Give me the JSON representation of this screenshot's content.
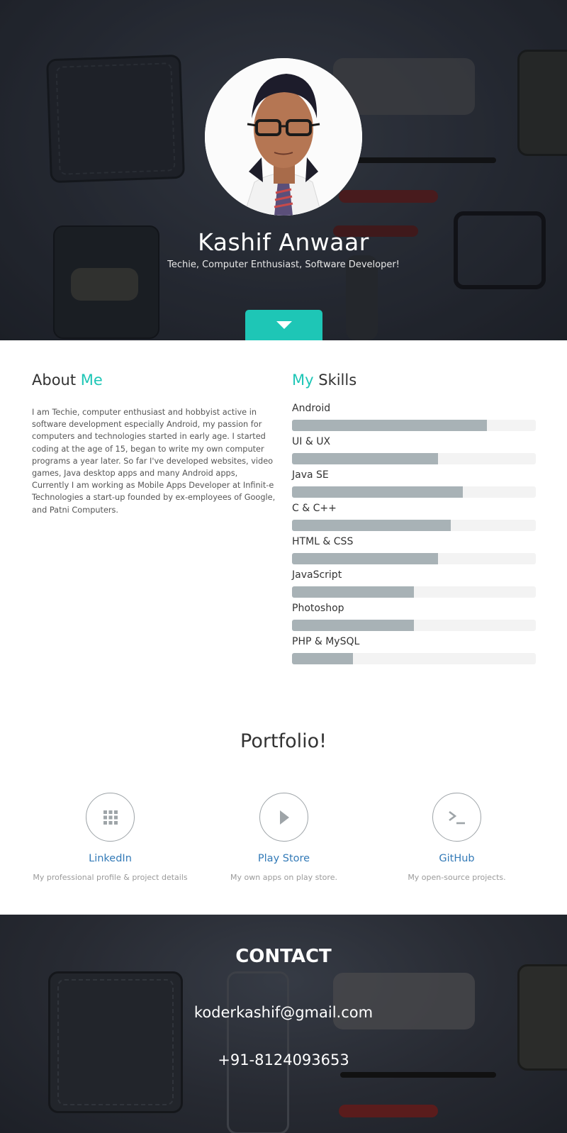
{
  "hero": {
    "name": "Kashif Anwaar",
    "tagline": "Techie, Computer Enthusiast, Software Developer!",
    "scroll_icon": "caret-down-icon",
    "accent_color": "#1ec6b6"
  },
  "about": {
    "title_plain": "About",
    "title_accent": "Me",
    "text": "I am Techie, computer enthusiast and hobbyist active in software development especially Android, my passion for computers and technologies started in early age. I started coding at the age of 15, began to write my own computer programs a year later. So far I've developed websites, video games, Java desktop apps and many Android apps, Currently I am working as Mobile Apps Developer at Infinit-e Technologies a start-up founded by ex-employees of Google, and Patni Computers."
  },
  "skills": {
    "title_accent": "My",
    "title_plain": "Skills",
    "items": [
      {
        "label": "Android",
        "level": 0.8
      },
      {
        "label": "UI & UX",
        "level": 0.6
      },
      {
        "label": "Java SE",
        "level": 0.7
      },
      {
        "label": "C & C++",
        "level": 0.65
      },
      {
        "label": "HTML & CSS",
        "level": 0.6
      },
      {
        "label": "JavaScript",
        "level": 0.5
      },
      {
        "label": "Photoshop",
        "level": 0.5
      },
      {
        "label": "PHP & MySQL",
        "level": 0.25
      }
    ]
  },
  "portfolio": {
    "title": "Portfolio!",
    "items": [
      {
        "label": "LinkedIn",
        "description": "My professional profile & project details",
        "icon": "grid-icon"
      },
      {
        "label": "Play Store",
        "description": "My own apps on play store.",
        "icon": "play-icon"
      },
      {
        "label": "GitHub",
        "description": "My open-source projects.",
        "icon": "terminal-icon"
      }
    ]
  },
  "contact": {
    "title": "CONTACT",
    "email": "koderkashif@gmail.com",
    "phone": "+91-8124093653"
  }
}
